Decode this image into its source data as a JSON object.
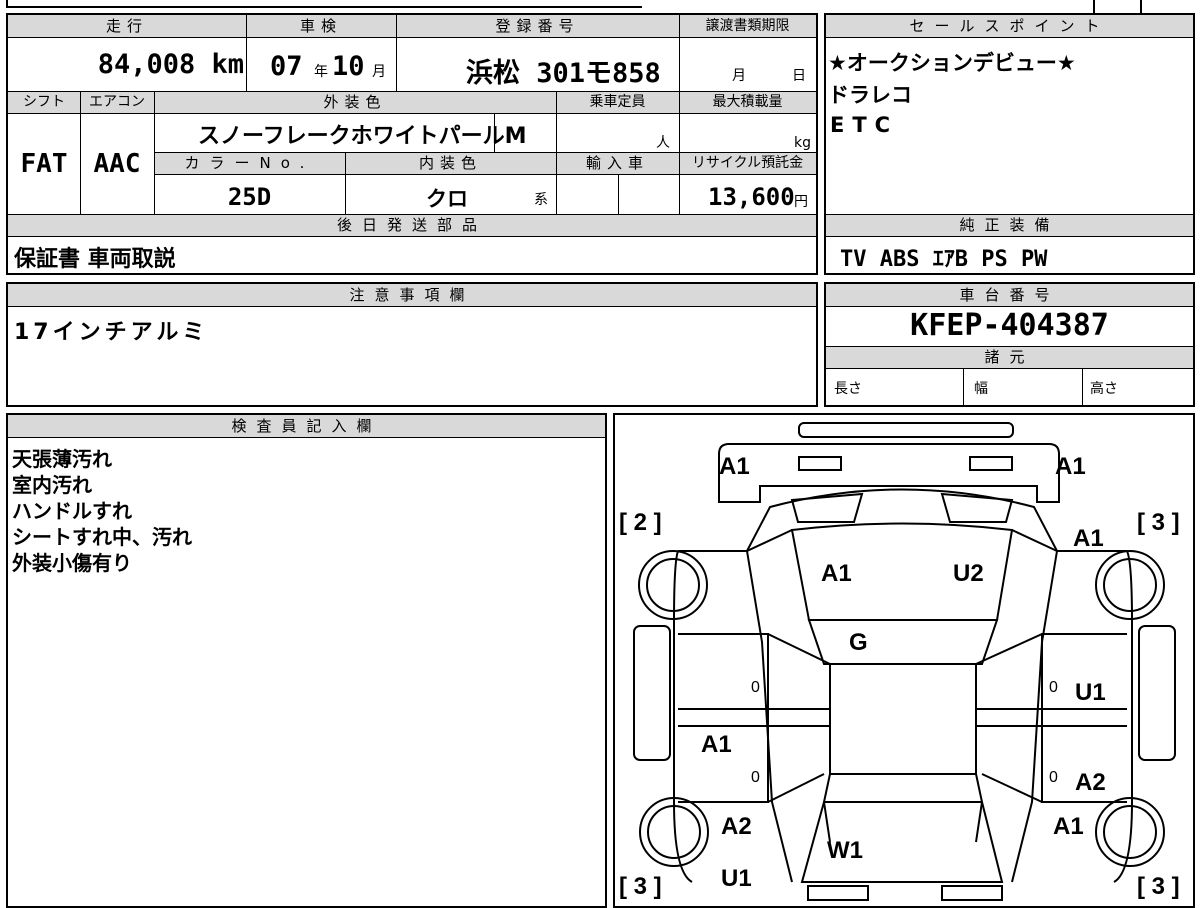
{
  "info": {
    "mileage_label": "走行",
    "mileage_value": "84,008 km",
    "inspection_label": "車検",
    "inspection_year": "07",
    "inspection_year_unit": "年",
    "inspection_month": "10",
    "inspection_month_unit": "月",
    "plate_label": "登録番号",
    "plate_value": "浜松 301モ858",
    "transfer_label": "譲渡書類期限",
    "transfer_month_unit": "月",
    "transfer_day_unit": "日",
    "shift_label": "シフト",
    "shift_value": "FAT",
    "ac_label": "エアコン",
    "ac_value": "AAC",
    "exterior_label": "外装色",
    "exterior_value": "スノーフレークホワイトパールM",
    "capacity_label": "乗車定員",
    "capacity_unit": "人",
    "maxload_label": "最大積載量",
    "maxload_unit": "kg",
    "color_no_label": "カラーNo.",
    "color_no_value": "25D",
    "interior_label": "内装色",
    "interior_value": "クロ",
    "interior_suffix": "系",
    "import_label": "輸入車",
    "recycle_label": "リサイクル預託金",
    "recycle_value": "13,600",
    "recycle_unit": "円",
    "later_parts_label": "後日発送部品",
    "later_parts_value": "保証書 車両取説"
  },
  "sales_points": {
    "label": "セールスポイント",
    "lines": [
      "★オークションデビュー★",
      "ドラレコ",
      "ETC"
    ]
  },
  "equipment": {
    "label": "純正装備",
    "value": "TV ABS ｴｱB PS PW"
  },
  "notes": {
    "label": "注意事項欄",
    "value": "17インチアルミ"
  },
  "chassis": {
    "label": "車台番号",
    "value": "KFEP-404387",
    "specs_label": "諸元",
    "length_label": "長さ",
    "width_label": "幅",
    "height_label": "高さ"
  },
  "inspector": {
    "label": "検査員記入欄",
    "lines": [
      "天張薄汚れ",
      "室内汚れ",
      "ハンドルすれ",
      "シートすれ中、汚れ",
      "外装小傷有り"
    ]
  },
  "diagram": {
    "codes": [
      "A1",
      "A1",
      "A1",
      "A1",
      "U2",
      "G",
      "U1",
      "A1",
      "A2",
      "A2",
      "A1",
      "W1",
      "U1"
    ],
    "zeros": [
      "0",
      "0",
      "0",
      "0"
    ],
    "brackets": [
      "[ 2 ]",
      "[ 3 ]",
      "[ 3 ]",
      "[ 3 ]"
    ]
  }
}
